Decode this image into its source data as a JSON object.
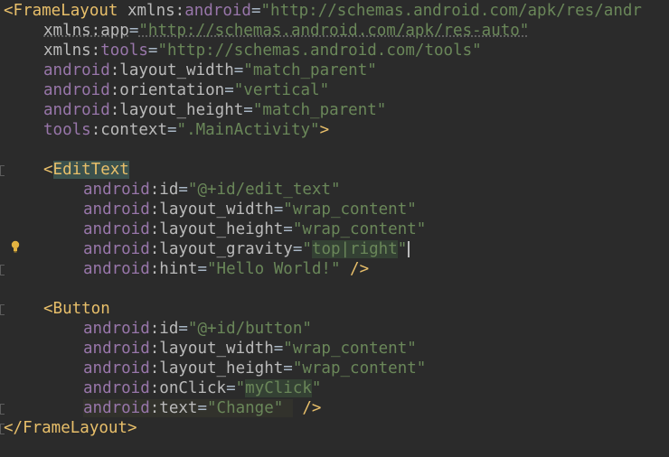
{
  "editor": {
    "lines": [
      {
        "segments": [
          {
            "cls": "tag",
            "text": "<FrameLayout "
          },
          {
            "cls": "attr",
            "text": "xmlns:"
          },
          {
            "cls": "ns",
            "text": "android"
          },
          {
            "cls": "plain",
            "text": "="
          },
          {
            "cls": "val",
            "text": "\"http://schemas.android.com/apk/res/andr"
          }
        ]
      },
      {
        "segments": [
          {
            "cls": "attr underline-dim",
            "text": "xmlns:app"
          },
          {
            "cls": "plain",
            "text": "="
          },
          {
            "cls": "val underline-dim",
            "text": "\"http://schemas.android.com/apk/res-auto\""
          }
        ]
      },
      {
        "segments": [
          {
            "cls": "attr",
            "text": "xmlns:"
          },
          {
            "cls": "ns",
            "text": "tools"
          },
          {
            "cls": "plain",
            "text": "="
          },
          {
            "cls": "val",
            "text": "\"http://schemas.android.com/tools\""
          }
        ]
      },
      {
        "segments": [
          {
            "cls": "ns",
            "text": "android"
          },
          {
            "cls": "attr",
            "text": ":layout_width"
          },
          {
            "cls": "plain",
            "text": "="
          },
          {
            "cls": "val",
            "text": "\"match_parent\""
          }
        ]
      },
      {
        "segments": [
          {
            "cls": "ns",
            "text": "android"
          },
          {
            "cls": "attr",
            "text": ":orientation"
          },
          {
            "cls": "plain",
            "text": "="
          },
          {
            "cls": "val",
            "text": "\"vertical\""
          }
        ]
      },
      {
        "segments": [
          {
            "cls": "ns",
            "text": "android"
          },
          {
            "cls": "attr",
            "text": ":layout_height"
          },
          {
            "cls": "plain",
            "text": "="
          },
          {
            "cls": "val",
            "text": "\"match_parent\""
          }
        ]
      },
      {
        "segments": [
          {
            "cls": "ns",
            "text": "tools"
          },
          {
            "cls": "attr",
            "text": ":context"
          },
          {
            "cls": "plain",
            "text": "="
          },
          {
            "cls": "val",
            "text": "\".MainActivity\""
          },
          {
            "cls": "tag",
            "text": ">"
          }
        ]
      },
      {
        "segments": []
      },
      {
        "segments": [
          {
            "cls": "tag",
            "text": "<"
          },
          {
            "cls": "tag hl-tag",
            "text": "EditText"
          }
        ]
      },
      {
        "segments": [
          {
            "cls": "ns",
            "text": "android"
          },
          {
            "cls": "attr",
            "text": ":id"
          },
          {
            "cls": "plain",
            "text": "="
          },
          {
            "cls": "val",
            "text": "\"@+id/edit_text\""
          }
        ]
      },
      {
        "segments": [
          {
            "cls": "ns",
            "text": "android"
          },
          {
            "cls": "attr",
            "text": ":layout_width"
          },
          {
            "cls": "plain",
            "text": "="
          },
          {
            "cls": "val",
            "text": "\"wrap_content\""
          }
        ]
      },
      {
        "segments": [
          {
            "cls": "ns",
            "text": "android"
          },
          {
            "cls": "attr",
            "text": ":layout_height"
          },
          {
            "cls": "plain",
            "text": "="
          },
          {
            "cls": "val",
            "text": "\"wrap_content\""
          }
        ]
      },
      {
        "segments": [
          {
            "cls": "ns",
            "text": "android"
          },
          {
            "cls": "attr",
            "text": ":layout_gravity"
          },
          {
            "cls": "plain",
            "text": "="
          },
          {
            "cls": "val",
            "text": "\""
          },
          {
            "cls": "val hl-val",
            "text": "top|right"
          },
          {
            "cls": "val",
            "text": "\""
          }
        ]
      },
      {
        "segments": [
          {
            "cls": "ns",
            "text": "android"
          },
          {
            "cls": "attr",
            "text": ":hint"
          },
          {
            "cls": "plain",
            "text": "="
          },
          {
            "cls": "val",
            "text": "\"Hello World!\""
          },
          {
            "cls": "tag",
            "text": " />"
          }
        ]
      },
      {
        "segments": []
      },
      {
        "segments": [
          {
            "cls": "tag",
            "text": "<Button"
          }
        ]
      },
      {
        "segments": [
          {
            "cls": "ns",
            "text": "android"
          },
          {
            "cls": "attr",
            "text": ":id"
          },
          {
            "cls": "plain",
            "text": "="
          },
          {
            "cls": "val",
            "text": "\"@+id/button\""
          }
        ]
      },
      {
        "segments": [
          {
            "cls": "ns",
            "text": "android"
          },
          {
            "cls": "attr",
            "text": ":layout_width"
          },
          {
            "cls": "plain",
            "text": "="
          },
          {
            "cls": "val",
            "text": "\"wrap_content\""
          }
        ]
      },
      {
        "segments": [
          {
            "cls": "ns",
            "text": "android"
          },
          {
            "cls": "attr",
            "text": ":layout_height"
          },
          {
            "cls": "plain",
            "text": "="
          },
          {
            "cls": "val",
            "text": "\"wrap_content\""
          }
        ]
      },
      {
        "segments": [
          {
            "cls": "ns",
            "text": "android"
          },
          {
            "cls": "attr",
            "text": ":onClick"
          },
          {
            "cls": "plain",
            "text": "="
          },
          {
            "cls": "val",
            "text": "\""
          },
          {
            "cls": "val hl-val",
            "text": "myClick"
          },
          {
            "cls": "val",
            "text": "\""
          }
        ]
      },
      {
        "segments": [
          {
            "cls": "ns hl-line",
            "text": "android"
          },
          {
            "cls": "attr hl-line",
            "text": ":text"
          },
          {
            "cls": "plain hl-line",
            "text": "="
          },
          {
            "cls": "val hl-line",
            "text": "\"Change\" "
          },
          {
            "cls": "tag",
            "text": " />"
          }
        ]
      },
      {
        "segments": [
          {
            "cls": "tag",
            "text": "</FrameLayout>"
          }
        ]
      }
    ]
  }
}
